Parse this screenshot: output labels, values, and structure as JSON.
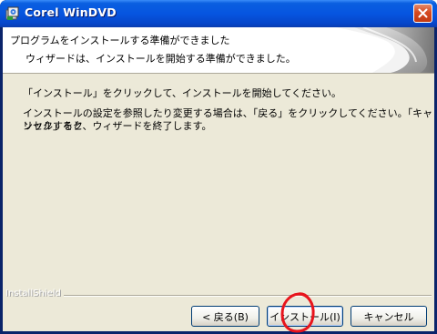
{
  "window": {
    "title": "Corel WinDVD"
  },
  "header": {
    "title": "プログラムをインストールする準備ができました",
    "subtitle": "ウィザードは、インストールを開始する準備ができました。"
  },
  "body": {
    "instruction": "「インストール」をクリックして、インストールを開始してください。",
    "paragraph_line1": "インストールの設定を参照したり変更する場合は、「戻る」をクリックしてください。「キャンセル」をク",
    "paragraph_line2": "リックすると、ウィザードを終了します。"
  },
  "footer": {
    "brand": "InstallShield"
  },
  "buttons": {
    "back": "< 戻る(B)",
    "install": "インストール(I)",
    "cancel": "キャンセル"
  },
  "colors": {
    "titlebar": "#0655e0",
    "close": "#d64a20",
    "annotation": "#e8141c"
  }
}
